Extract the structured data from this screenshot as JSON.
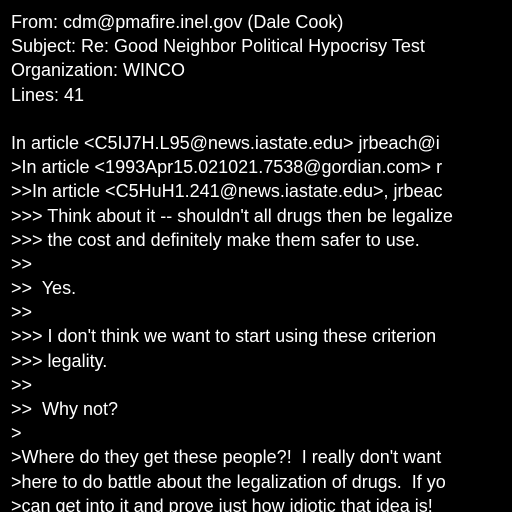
{
  "background_color": "#000000",
  "text_color": "#ffffff",
  "header": {
    "from": "From: cdm@pmafire.inel.gov (Dale Cook)",
    "subject": "Subject: Re: Good Neighbor Political Hypocrisy Test",
    "organization": "Organization: WINCO",
    "lines": "Lines: 41"
  },
  "body_lines": [
    "In article <C5IJ7H.L95@news.iastate.edu> jrbeach@i",
    ">In article <1993Apr15.021021.7538@gordian.com> r",
    ">>In article <C5HuH1.241@news.iastate.edu>, jrbeac",
    ">>> Think about it -- shouldn't all drugs then be legalize",
    ">>> the cost and definitely make them safer to use.",
    ">>",
    ">>  Yes.",
    ">>",
    ">>> I don't think we want to start using these criterion",
    ">>> legality.",
    ">>",
    ">>  Why not?",
    ">",
    ">Where do they get these people?!  I really don't want",
    ">here to do battle about the legalization of drugs.  If yo",
    ">can get into it and prove just how idiotic that idea is!"
  ]
}
